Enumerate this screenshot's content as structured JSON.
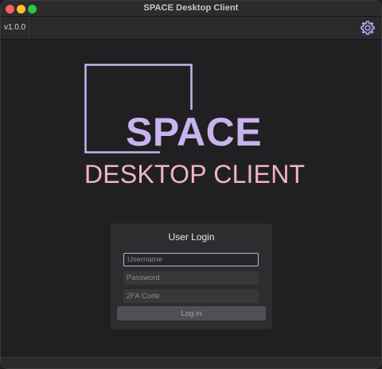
{
  "window": {
    "title": "SPACE Desktop Client"
  },
  "toolbar": {
    "version": "v1.0.0",
    "settings_icon": "gear-icon"
  },
  "logo": {
    "title": "SPACE",
    "subtitle": "DESKTOP CLIENT",
    "title_color": "#c9b3ec",
    "subtitle_color": "#f0b5c1"
  },
  "login": {
    "heading": "User Login",
    "username": {
      "value": "",
      "placeholder": "Username"
    },
    "password": {
      "value": "",
      "placeholder": "Password"
    },
    "twofa": {
      "value": "",
      "placeholder": "2FA Code"
    },
    "button_label": "Log in"
  }
}
